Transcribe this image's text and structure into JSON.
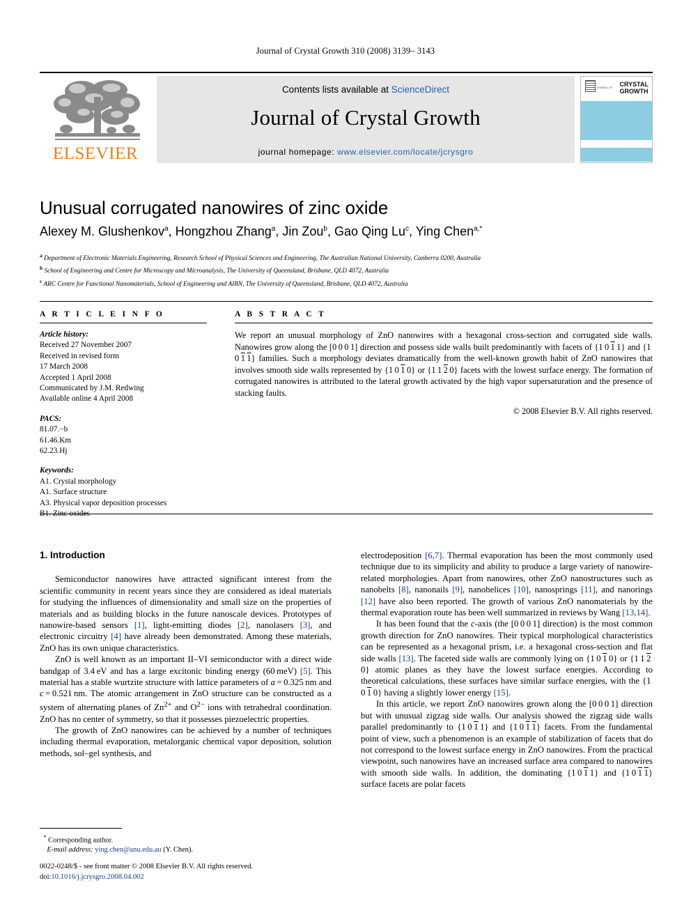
{
  "running_head": "Journal of Crystal Growth 310 (2008) 3139– 3143",
  "masthead": {
    "contents_prefix": "Contents lists available at ",
    "sciencedirect": "ScienceDirect",
    "journal_name": "Journal of Crystal Growth",
    "homepage_label": "journal homepage: ",
    "homepage_url": "www.elsevier.com/locate/jcrysgro",
    "publisher": "ELSEVIER",
    "cover": {
      "pre_title": "JOURNAL OF",
      "title_line1": "CRYSTAL",
      "title_line2": "GROWTH",
      "band_color": "#8ccde1"
    },
    "accent_link_color": "#2062b4",
    "elsevier_orange": "#F07E18"
  },
  "article": {
    "title": "Unusual corrugated nanowires of zinc oxide",
    "authors": [
      {
        "name": "Alexey M. Glushenkov",
        "marks": "a"
      },
      {
        "name": "Hongzhou Zhang",
        "marks": "a"
      },
      {
        "name": "Jin Zou",
        "marks": "b"
      },
      {
        "name": "Gao Qing Lu",
        "marks": "c"
      },
      {
        "name": "Ying Chen",
        "marks": "a,*"
      }
    ],
    "affiliations": [
      {
        "mark": "a",
        "text": "Department of Electronic Materials Engineering, Research School of Physical Sciences and Engineering, The Australian National University, Canberra 0200, Australia"
      },
      {
        "mark": "b",
        "text": "School of Engineering and Centre for Microscopy and Microanalysis, The University of Queensland, Brisbane, QLD 4072, Australia"
      },
      {
        "mark": "c",
        "text": "ARC Centre for Functional Nanomaterials, School of Engineering and AIBN, The University of Queensland, Brisbane, QLD 4072, Australia"
      }
    ]
  },
  "article_info": {
    "heading": "A R T I C L E   I N F O",
    "history_label": "Article history:",
    "history": [
      "Received 27 November 2007",
      "Received in revised form",
      "17 March 2008",
      "Accepted 1 April 2008",
      "Communicated by J.M. Redwing",
      "Available online 4 April 2008"
    ],
    "pacs_label": "PACS:",
    "pacs": [
      "81.07.−b",
      "61.46.Km",
      "62.23.Hj"
    ],
    "keywords_label": "Keywords:",
    "keywords": [
      "A1. Crystal morphology",
      "A1. Surface structure",
      "A3. Physical vapor deposition processes",
      "B1. Zinc oxides"
    ]
  },
  "abstract": {
    "heading": "A B S T R A C T",
    "copyright": "© 2008 Elsevier B.V. All rights reserved."
  },
  "body": {
    "intro_heading": "1. Introduction"
  },
  "footnote": {
    "corresponding": "Corresponding author.",
    "email_label": "E-mail address:",
    "email": "ying.chen@anu.edu.au",
    "email_owner": "(Y. Chen)."
  },
  "footer": {
    "issn_line": "0022-0248/$ - see front matter © 2008 Elsevier B.V. All rights reserved.",
    "doi_label": "doi:",
    "doi": "10.1016/j.jcrysgro.2008.04.002"
  }
}
